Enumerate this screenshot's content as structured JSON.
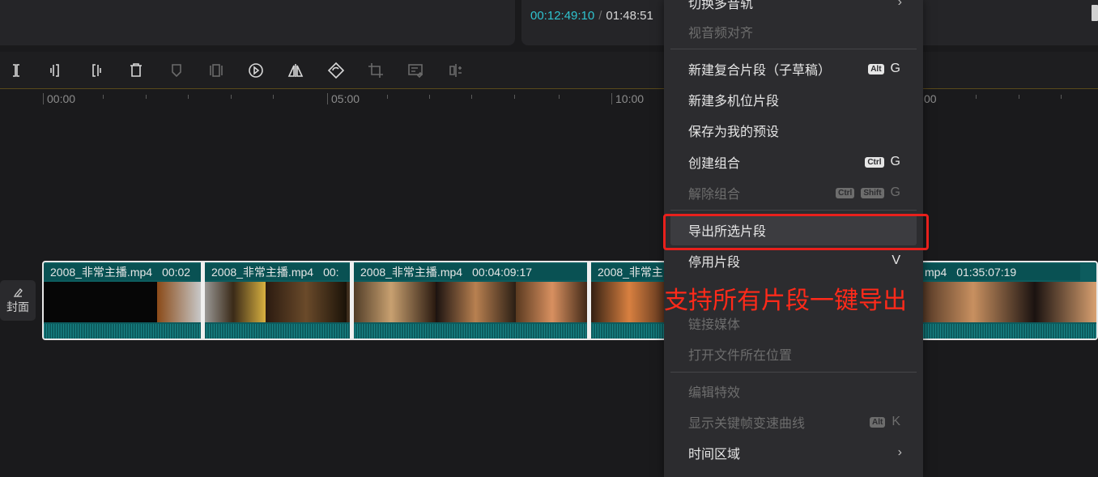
{
  "player": {
    "current_time": "00:12:49:10",
    "separator": "/",
    "total_time": "01:48:51"
  },
  "toolbar": {
    "colors": {
      "icon": "#d8d8d8",
      "icon_disabled": "#6a6a6a"
    },
    "tools": [
      {
        "icon": "split-icon",
        "enabled": true
      },
      {
        "icon": "trim-left-icon",
        "enabled": true
      },
      {
        "icon": "trim-right-icon",
        "enabled": true
      },
      {
        "icon": "delete-icon",
        "enabled": true
      },
      {
        "icon": "marker-icon",
        "enabled": false
      },
      {
        "icon": "freeze-icon",
        "enabled": false
      },
      {
        "icon": "reverse-play-icon",
        "enabled": true
      },
      {
        "icon": "mirror-icon",
        "enabled": true
      },
      {
        "icon": "rotate-icon",
        "enabled": true
      },
      {
        "icon": "crop-icon",
        "enabled": false
      },
      {
        "icon": "edit-frame-icon",
        "enabled": false
      },
      {
        "icon": "smart-crop-icon",
        "enabled": false
      }
    ]
  },
  "ruler": {
    "labels": [
      "00:00",
      "05:00",
      "10:00",
      "00"
    ]
  },
  "cover": {
    "label": "封面"
  },
  "track": {
    "clips": [
      {
        "name": "2008_非常主播.mp4",
        "duration": "00:02"
      },
      {
        "name": "2008_非常主播.mp4",
        "duration": "00:"
      },
      {
        "name": "2008_非常主播.mp4",
        "duration": "00:04:09:17"
      },
      {
        "name": "2008_非常主",
        "duration": ""
      },
      {
        "name": "mp4",
        "duration": "01:35:07:19"
      }
    ]
  },
  "context_menu": {
    "items": [
      {
        "label": "切换多音轨",
        "disabled": false,
        "arrow": "›"
      },
      {
        "label": "视音频对齐",
        "disabled": true
      },
      {
        "label": "新建复合片段（子草稿）",
        "disabled": false,
        "keys": [
          "Alt"
        ],
        "letter": "G"
      },
      {
        "label": "新建多机位片段",
        "disabled": false
      },
      {
        "label": "保存为我的预设",
        "disabled": false
      },
      {
        "label": "创建组合",
        "disabled": false,
        "keys": [
          "Ctrl"
        ],
        "letter": "G"
      },
      {
        "label": "解除组合",
        "disabled": true,
        "keys": [
          "Ctrl",
          "Shift"
        ],
        "letter": "G"
      },
      {
        "label": "导出所选片段",
        "disabled": false,
        "hover": true
      },
      {
        "label": "停用片段",
        "disabled": false,
        "letter": "V"
      },
      {
        "label": "链接媒体",
        "disabled": true
      },
      {
        "label": "打开文件所在位置",
        "disabled": true
      },
      {
        "label": "编辑特效",
        "disabled": true
      },
      {
        "label": "显示关键帧变速曲线",
        "disabled": true,
        "keys": [
          "Alt"
        ],
        "letter": "K"
      },
      {
        "label": "时间区域",
        "disabled": false,
        "arrow": "›"
      }
    ]
  },
  "annotation": {
    "text": "支持所有片段一键导出",
    "color": "#ff2a1a"
  }
}
